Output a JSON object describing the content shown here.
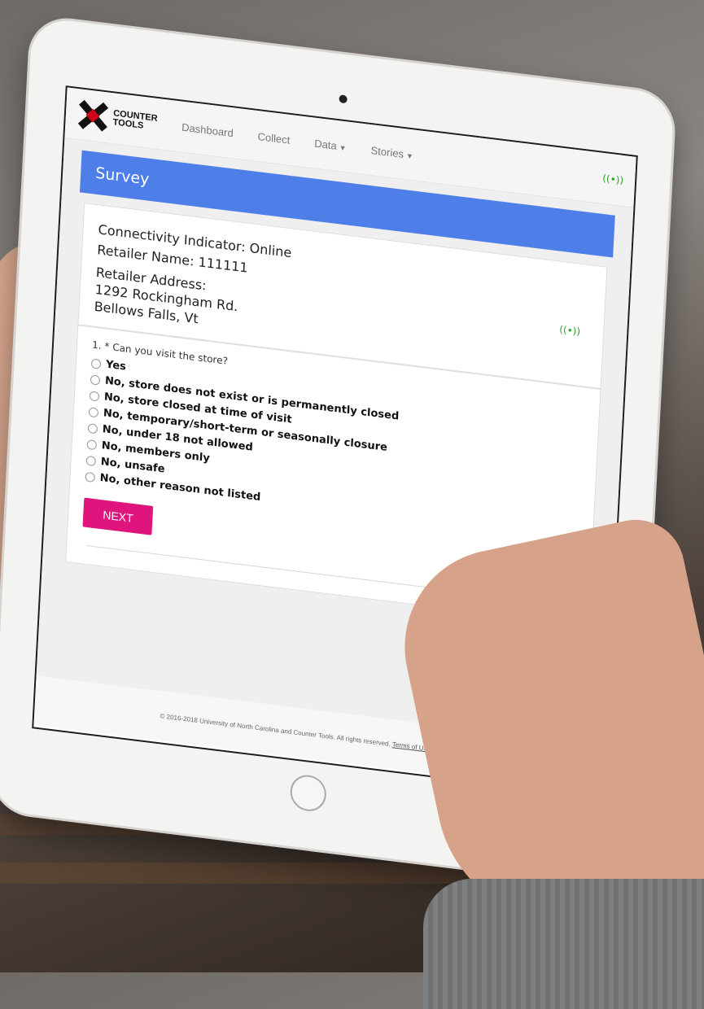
{
  "navbar": {
    "logo_line1": "COUNTER",
    "logo_line2": "TOOLS",
    "items": [
      "Dashboard",
      "Collect",
      "Data",
      "Stories"
    ],
    "connectivity_icon": "wifi-signal-icon"
  },
  "survey": {
    "title": "Survey",
    "connectivity": "Connectivity Indicator: Online",
    "retailer_name": "Retailer Name: 111111",
    "retailer_address_label": "Retailer Address:",
    "address_line1": "1292 Rockingham Rd.",
    "address_line2": "Bellows Falls, Vt",
    "question": "1. * Can you visit the store?",
    "options": [
      "Yes",
      "No, store does not exist or is permanently closed",
      "No, store closed at time of visit",
      "No, temporary/short-term or seasonally closure",
      "No, under 18 not allowed",
      "No, members only",
      "No, unsafe",
      "No, other reason not listed"
    ],
    "next_label": "NEXT"
  },
  "footer": {
    "copyright": "© 2016-2018 University of North Carolina and Counter Tools. All rights reserved.",
    "link": "Terms of Use & Privacy Policy"
  },
  "colors": {
    "header_blue": "#4e7fe8",
    "next_pink": "#e0147d",
    "online_green": "#2aa52a"
  }
}
